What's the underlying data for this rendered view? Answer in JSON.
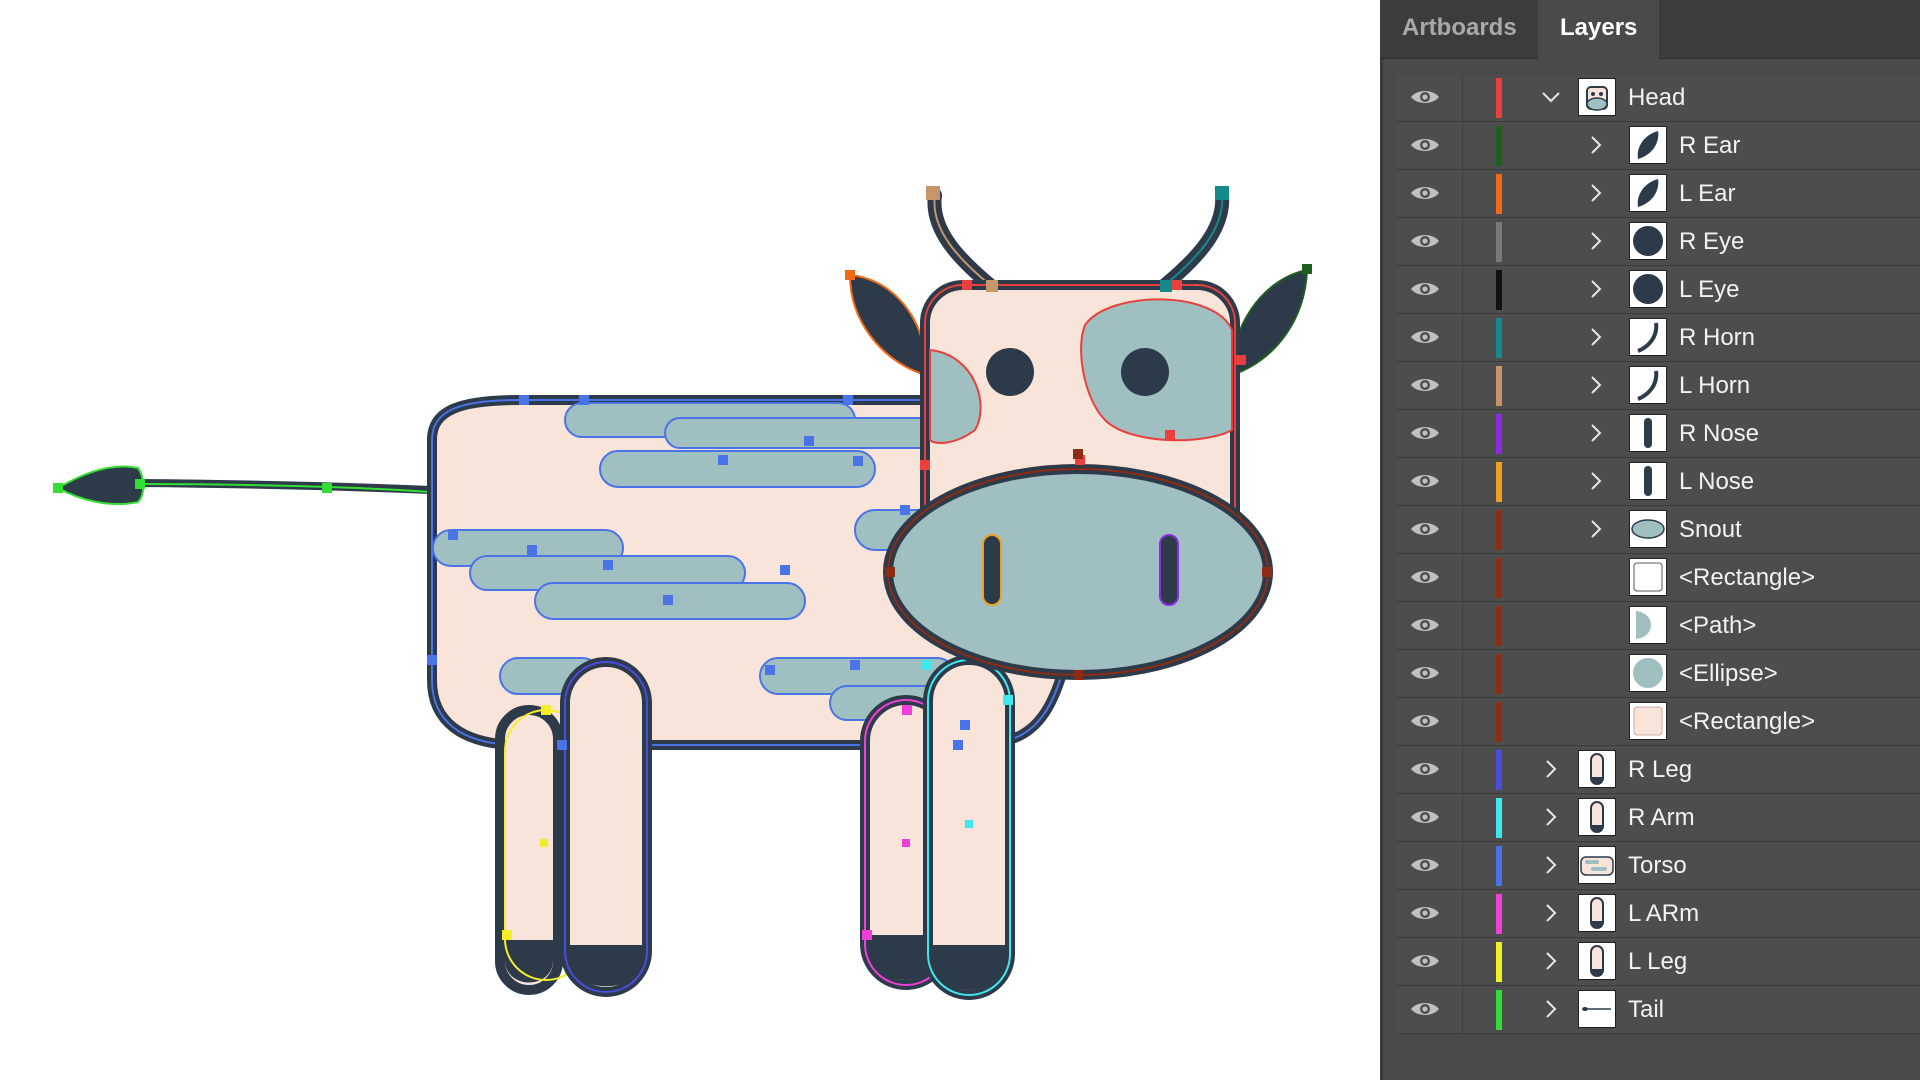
{
  "panel": {
    "tabs": [
      {
        "label": "Artboards",
        "active": false
      },
      {
        "label": "Layers",
        "active": true
      }
    ],
    "layers": [
      {
        "name": "Head",
        "color": "#e8403f",
        "depth": 0,
        "expand": "open",
        "thumb": "cow-head-thumb"
      },
      {
        "name": "R Ear",
        "color": "#1e5e1e",
        "depth": 1,
        "expand": "closed",
        "thumb": "ear-shape-thumb"
      },
      {
        "name": "L Ear",
        "color": "#f06a18",
        "depth": 1,
        "expand": "closed",
        "thumb": "ear-shape-thumb"
      },
      {
        "name": "R Eye",
        "color": "#7a7a7a",
        "depth": 1,
        "expand": "closed",
        "thumb": "eye-circle-thumb"
      },
      {
        "name": "L Eye",
        "color": "#111111",
        "depth": 1,
        "expand": "closed",
        "thumb": "eye-circle-thumb"
      },
      {
        "name": "R Horn",
        "color": "#148a8a",
        "depth": 1,
        "expand": "closed",
        "thumb": "horn-curve-thumb"
      },
      {
        "name": "L Horn",
        "color": "#c4966a",
        "depth": 1,
        "expand": "closed",
        "thumb": "horn-curve-thumb"
      },
      {
        "name": "R Nose",
        "color": "#8a2be2",
        "depth": 1,
        "expand": "closed",
        "thumb": "nostril-thumb"
      },
      {
        "name": "L Nose",
        "color": "#f0a020",
        "depth": 1,
        "expand": "closed",
        "thumb": "nostril-thumb"
      },
      {
        "name": "Snout",
        "color": "#8e2b14",
        "depth": 1,
        "expand": "closed",
        "thumb": "snout-ellipse-thumb"
      },
      {
        "name": "<Rectangle>",
        "color": "#8e2b14",
        "depth": 2,
        "expand": "none",
        "thumb": "rectangle-white-thumb"
      },
      {
        "name": "<Path>",
        "color": "#8e2b14",
        "depth": 2,
        "expand": "none",
        "thumb": "path-half-thumb"
      },
      {
        "name": "<Ellipse>",
        "color": "#8e2b14",
        "depth": 2,
        "expand": "none",
        "thumb": "ellipse-thumb"
      },
      {
        "name": "<Rectangle>",
        "color": "#8e2b14",
        "depth": 2,
        "expand": "none",
        "thumb": "rectangle-pink-thumb"
      },
      {
        "name": "R Leg",
        "color": "#4b4bdc",
        "depth": 0,
        "expand": "closed",
        "thumb": "leg-thumb"
      },
      {
        "name": "R Arm",
        "color": "#3ee8ef",
        "depth": 0,
        "expand": "closed",
        "thumb": "leg-thumb"
      },
      {
        "name": "Torso",
        "color": "#4a73e8",
        "depth": 0,
        "expand": "closed",
        "thumb": "torso-thumb"
      },
      {
        "name": "L ARm",
        "color": "#ef3fd6",
        "depth": 0,
        "expand": "closed",
        "thumb": "leg-thumb"
      },
      {
        "name": "L Leg",
        "color": "#f2ef2a",
        "depth": 0,
        "expand": "closed",
        "thumb": "leg-thumb"
      },
      {
        "name": "Tail",
        "color": "#33dd33",
        "depth": 0,
        "expand": "closed",
        "thumb": "tail-thumb"
      }
    ]
  },
  "colors": {
    "body_fill": "#f9e4da",
    "spot_fill": "#9fbfc1",
    "outline": "#2d3a4a",
    "panel_bg": "#4a4a4a"
  }
}
